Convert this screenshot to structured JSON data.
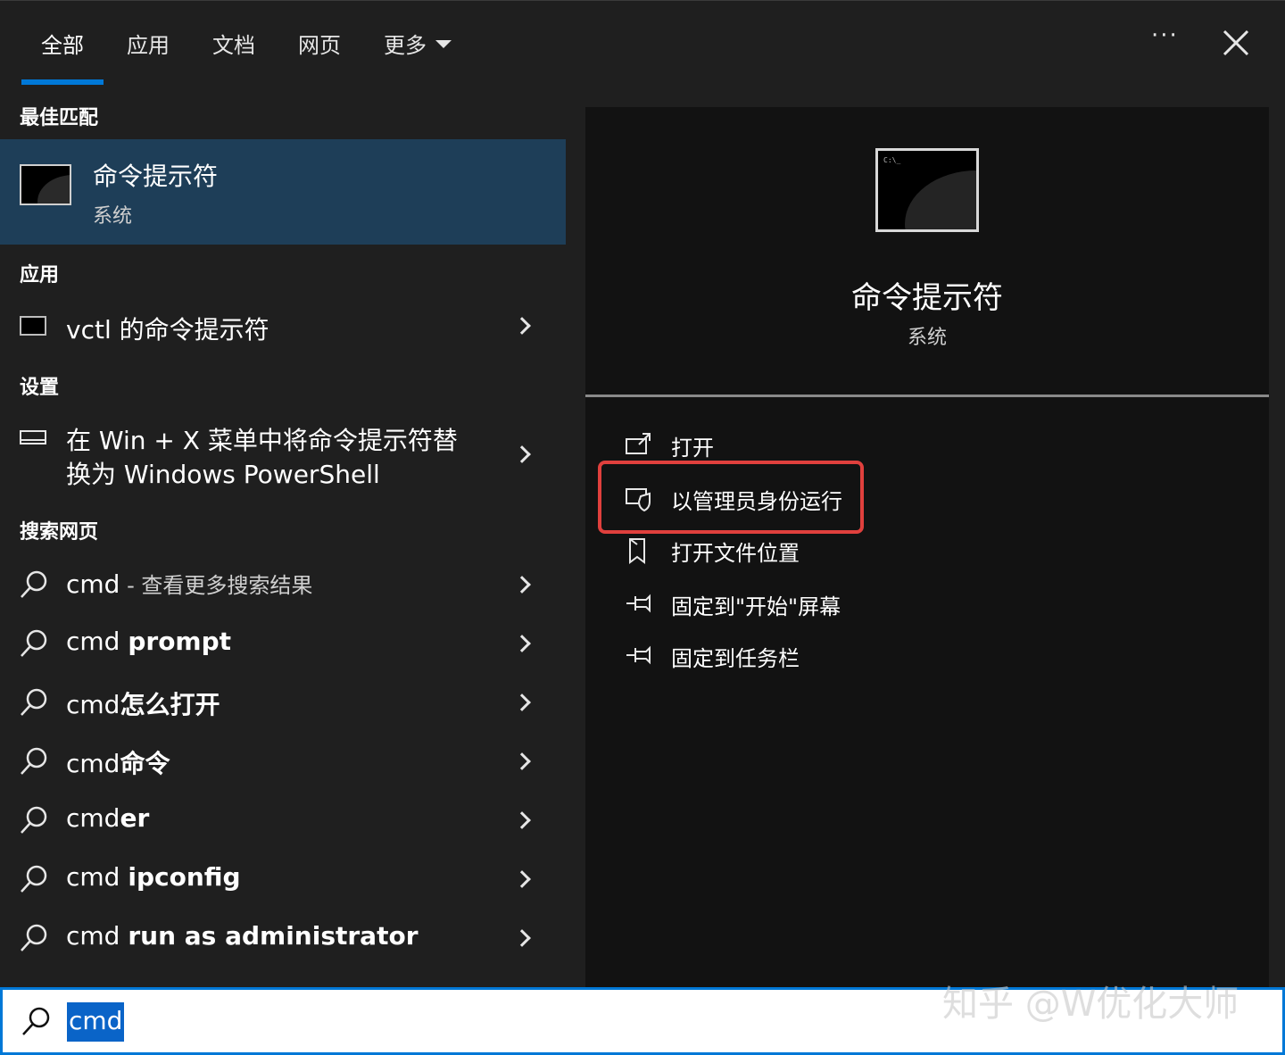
{
  "tabs": [
    {
      "label": "全部",
      "active": true
    },
    {
      "label": "应用",
      "active": false
    },
    {
      "label": "文档",
      "active": false
    },
    {
      "label": "网页",
      "active": false
    },
    {
      "label": "更多",
      "active": false
    }
  ],
  "more_label": "···",
  "sections": {
    "best_match": "最佳匹配",
    "apps": "应用",
    "settings": "设置",
    "web": "搜索网页"
  },
  "best_match": {
    "title": "命令提示符",
    "subtitle": "系统"
  },
  "apps": [
    {
      "label": "vctl 的命令提示符"
    }
  ],
  "settings": [
    {
      "line1": "在 Win + X 菜单中将命令提示符替",
      "line2": "换为 Windows PowerShell"
    }
  ],
  "web_results": [
    {
      "prefix": "cmd",
      "suffix": " - 查看更多搜索结果",
      "bold_suffix": false
    },
    {
      "prefix": "cmd ",
      "suffix": "prompt",
      "bold_suffix": true
    },
    {
      "prefix": "cmd",
      "suffix": "怎么打开",
      "bold_suffix": true
    },
    {
      "prefix": "cmd",
      "suffix": "命令",
      "bold_suffix": true
    },
    {
      "prefix": "cmd",
      "suffix": "er",
      "bold_suffix": true
    },
    {
      "prefix": "cmd ",
      "suffix": "ipconfig",
      "bold_suffix": true
    },
    {
      "prefix": "cmd ",
      "suffix": "run as administrator",
      "bold_suffix": true
    }
  ],
  "detail": {
    "title": "命令提示符",
    "subtitle": "系统",
    "icon_text": "C:\\_",
    "actions": [
      {
        "label": "打开",
        "icon": "open-icon"
      },
      {
        "label": "以管理员身份运行",
        "icon": "admin-shield-icon",
        "highlighted": true
      },
      {
        "label": "打开文件位置",
        "icon": "file-location-icon"
      },
      {
        "label": "固定到\"开始\"屏幕",
        "icon": "pin-icon"
      },
      {
        "label": "固定到任务栏",
        "icon": "pin-icon"
      }
    ]
  },
  "search": {
    "value": "cmd"
  },
  "watermark": "知乎 @W优化大师",
  "colors": {
    "accent": "#0078d7",
    "selected_row": "#1e3e58",
    "highlight_border": "#e0403d"
  }
}
